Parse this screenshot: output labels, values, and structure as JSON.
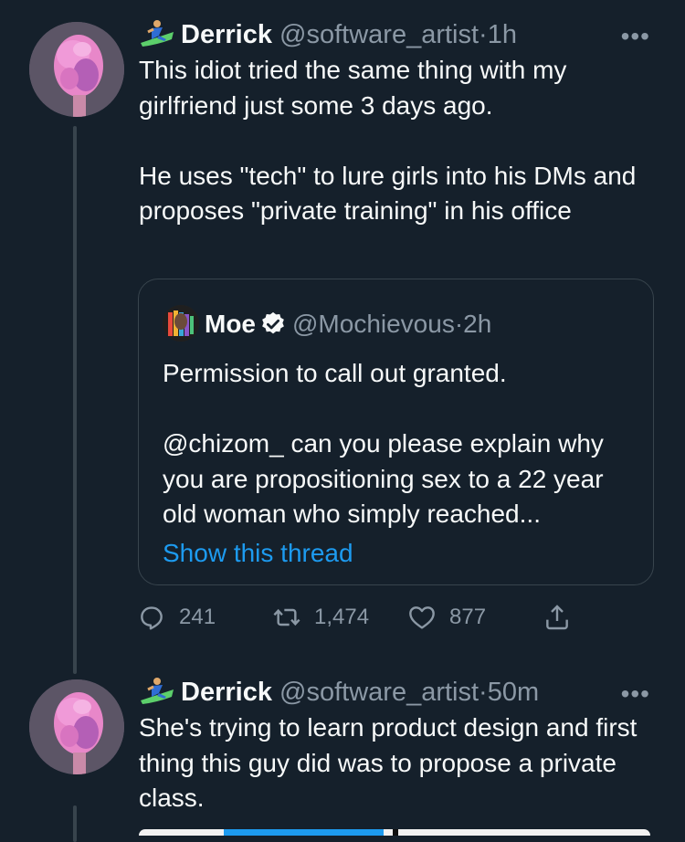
{
  "tweets": [
    {
      "name": "Derrick",
      "handle": "@software_artist",
      "dot": "·",
      "time": "1h",
      "more": "•••",
      "text": "This idiot tried the same thing with my girlfriend just some 3 days ago.\n\nHe uses \"tech\" to lure girls into his DMs and proposes \"private training\" in his office",
      "quote": {
        "name": "Moe",
        "handle": "@Mochievous",
        "dot": "·",
        "time": "2h",
        "text": "Permission to call out granted.\n\n@chizom_ can you please explain why you are propositioning sex to a 22 year old woman who simply reached...",
        "show_thread": "Show this thread"
      },
      "actions": {
        "replies": "241",
        "retweets": "1,474",
        "likes": "877"
      }
    },
    {
      "name": "Derrick",
      "handle": "@software_artist",
      "dot": "·",
      "time": "50m",
      "more": "•••",
      "text": "She's trying to learn product design and first thing this guy did was to propose a private class."
    }
  ],
  "icons": {
    "emoji": "person-surfing-emoji-icon",
    "verified": "verified-badge-icon",
    "reply": "reply-icon",
    "retweet": "retweet-icon",
    "like": "heart-icon",
    "share": "share-icon"
  },
  "colors": {
    "background": "#15202b",
    "text": "#f7f9f9",
    "secondary": "#8b98a5",
    "link": "#1d9bf0",
    "border": "#38444d"
  }
}
